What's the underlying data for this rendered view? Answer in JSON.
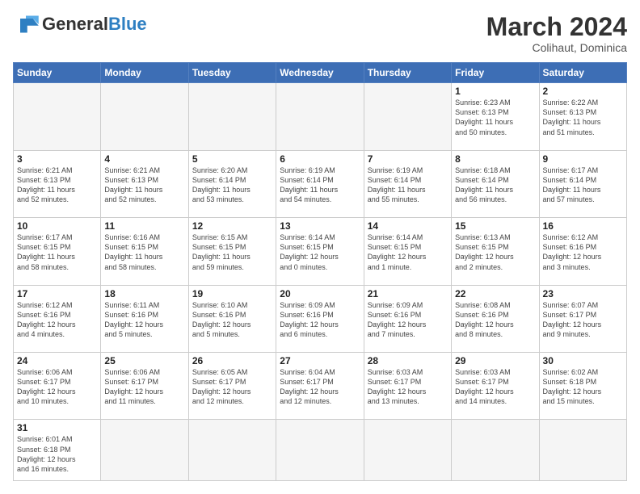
{
  "header": {
    "logo_general": "General",
    "logo_blue": "Blue",
    "month_year": "March 2024",
    "location": "Colihaut, Dominica"
  },
  "weekdays": [
    "Sunday",
    "Monday",
    "Tuesday",
    "Wednesday",
    "Thursday",
    "Friday",
    "Saturday"
  ],
  "weeks": [
    [
      {
        "day": "",
        "info": "",
        "empty": true
      },
      {
        "day": "",
        "info": "",
        "empty": true
      },
      {
        "day": "",
        "info": "",
        "empty": true
      },
      {
        "day": "",
        "info": "",
        "empty": true
      },
      {
        "day": "",
        "info": "",
        "empty": true
      },
      {
        "day": "1",
        "info": "Sunrise: 6:23 AM\nSunset: 6:13 PM\nDaylight: 11 hours\nand 50 minutes."
      },
      {
        "day": "2",
        "info": "Sunrise: 6:22 AM\nSunset: 6:13 PM\nDaylight: 11 hours\nand 51 minutes."
      }
    ],
    [
      {
        "day": "3",
        "info": "Sunrise: 6:21 AM\nSunset: 6:13 PM\nDaylight: 11 hours\nand 52 minutes."
      },
      {
        "day": "4",
        "info": "Sunrise: 6:21 AM\nSunset: 6:13 PM\nDaylight: 11 hours\nand 52 minutes."
      },
      {
        "day": "5",
        "info": "Sunrise: 6:20 AM\nSunset: 6:14 PM\nDaylight: 11 hours\nand 53 minutes."
      },
      {
        "day": "6",
        "info": "Sunrise: 6:19 AM\nSunset: 6:14 PM\nDaylight: 11 hours\nand 54 minutes."
      },
      {
        "day": "7",
        "info": "Sunrise: 6:19 AM\nSunset: 6:14 PM\nDaylight: 11 hours\nand 55 minutes."
      },
      {
        "day": "8",
        "info": "Sunrise: 6:18 AM\nSunset: 6:14 PM\nDaylight: 11 hours\nand 56 minutes."
      },
      {
        "day": "9",
        "info": "Sunrise: 6:17 AM\nSunset: 6:14 PM\nDaylight: 11 hours\nand 57 minutes."
      }
    ],
    [
      {
        "day": "10",
        "info": "Sunrise: 6:17 AM\nSunset: 6:15 PM\nDaylight: 11 hours\nand 58 minutes."
      },
      {
        "day": "11",
        "info": "Sunrise: 6:16 AM\nSunset: 6:15 PM\nDaylight: 11 hours\nand 58 minutes."
      },
      {
        "day": "12",
        "info": "Sunrise: 6:15 AM\nSunset: 6:15 PM\nDaylight: 11 hours\nand 59 minutes."
      },
      {
        "day": "13",
        "info": "Sunrise: 6:14 AM\nSunset: 6:15 PM\nDaylight: 12 hours\nand 0 minutes."
      },
      {
        "day": "14",
        "info": "Sunrise: 6:14 AM\nSunset: 6:15 PM\nDaylight: 12 hours\nand 1 minute."
      },
      {
        "day": "15",
        "info": "Sunrise: 6:13 AM\nSunset: 6:15 PM\nDaylight: 12 hours\nand 2 minutes."
      },
      {
        "day": "16",
        "info": "Sunrise: 6:12 AM\nSunset: 6:16 PM\nDaylight: 12 hours\nand 3 minutes."
      }
    ],
    [
      {
        "day": "17",
        "info": "Sunrise: 6:12 AM\nSunset: 6:16 PM\nDaylight: 12 hours\nand 4 minutes."
      },
      {
        "day": "18",
        "info": "Sunrise: 6:11 AM\nSunset: 6:16 PM\nDaylight: 12 hours\nand 5 minutes."
      },
      {
        "day": "19",
        "info": "Sunrise: 6:10 AM\nSunset: 6:16 PM\nDaylight: 12 hours\nand 5 minutes."
      },
      {
        "day": "20",
        "info": "Sunrise: 6:09 AM\nSunset: 6:16 PM\nDaylight: 12 hours\nand 6 minutes."
      },
      {
        "day": "21",
        "info": "Sunrise: 6:09 AM\nSunset: 6:16 PM\nDaylight: 12 hours\nand 7 minutes."
      },
      {
        "day": "22",
        "info": "Sunrise: 6:08 AM\nSunset: 6:16 PM\nDaylight: 12 hours\nand 8 minutes."
      },
      {
        "day": "23",
        "info": "Sunrise: 6:07 AM\nSunset: 6:17 PM\nDaylight: 12 hours\nand 9 minutes."
      }
    ],
    [
      {
        "day": "24",
        "info": "Sunrise: 6:06 AM\nSunset: 6:17 PM\nDaylight: 12 hours\nand 10 minutes."
      },
      {
        "day": "25",
        "info": "Sunrise: 6:06 AM\nSunset: 6:17 PM\nDaylight: 12 hours\nand 11 minutes."
      },
      {
        "day": "26",
        "info": "Sunrise: 6:05 AM\nSunset: 6:17 PM\nDaylight: 12 hours\nand 12 minutes."
      },
      {
        "day": "27",
        "info": "Sunrise: 6:04 AM\nSunset: 6:17 PM\nDaylight: 12 hours\nand 12 minutes."
      },
      {
        "day": "28",
        "info": "Sunrise: 6:03 AM\nSunset: 6:17 PM\nDaylight: 12 hours\nand 13 minutes."
      },
      {
        "day": "29",
        "info": "Sunrise: 6:03 AM\nSunset: 6:17 PM\nDaylight: 12 hours\nand 14 minutes."
      },
      {
        "day": "30",
        "info": "Sunrise: 6:02 AM\nSunset: 6:18 PM\nDaylight: 12 hours\nand 15 minutes."
      }
    ],
    [
      {
        "day": "31",
        "info": "Sunrise: 6:01 AM\nSunset: 6:18 PM\nDaylight: 12 hours\nand 16 minutes.",
        "last": true
      },
      {
        "day": "",
        "info": "",
        "empty": true,
        "last": true
      },
      {
        "day": "",
        "info": "",
        "empty": true,
        "last": true
      },
      {
        "day": "",
        "info": "",
        "empty": true,
        "last": true
      },
      {
        "day": "",
        "info": "",
        "empty": true,
        "last": true
      },
      {
        "day": "",
        "info": "",
        "empty": true,
        "last": true
      },
      {
        "day": "",
        "info": "",
        "empty": true,
        "last": true
      }
    ]
  ]
}
